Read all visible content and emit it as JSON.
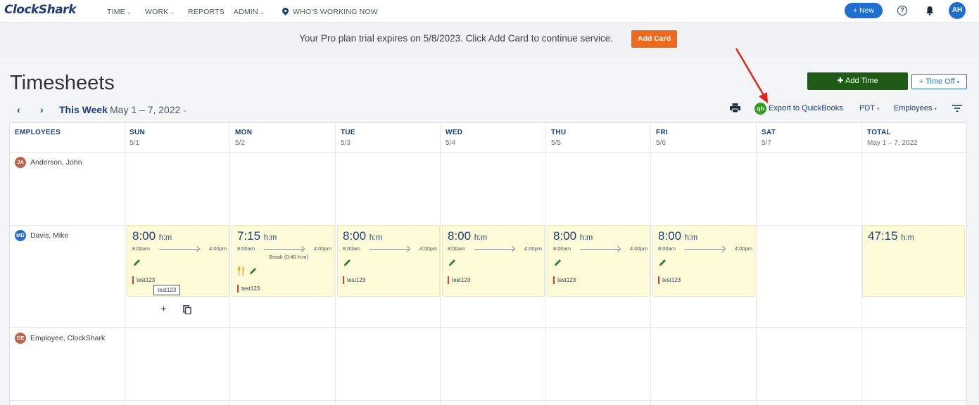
{
  "nav": {
    "logo": "ClockShark",
    "items": [
      "TIME",
      "WORK",
      "REPORTS",
      "ADMIN",
      "WHO'S WORKING NOW"
    ],
    "new_button": "+ New",
    "help_glyph": "?",
    "user_initials": "AH"
  },
  "banner": {
    "message": "Your Pro plan trial expires on 5/8/2023. Click Add Card to continue service.",
    "button": "Add Card"
  },
  "page": {
    "title": "Timesheets",
    "add_time": "Add Time",
    "time_off": "+ Time Off",
    "this_week": "This Week",
    "week_range": "May 1 – 7, 2022"
  },
  "toolbar": {
    "qb_logo": "qb",
    "export_qb": "Export to QuickBooks",
    "timezone": "PDT",
    "employees_filter": "Employees"
  },
  "table": {
    "employees_header": "EMPLOYEES",
    "days": [
      {
        "day": "SUN",
        "date": "5/1"
      },
      {
        "day": "MON",
        "date": "5/2"
      },
      {
        "day": "TUE",
        "date": "5/3"
      },
      {
        "day": "WED",
        "date": "5/4"
      },
      {
        "day": "THU",
        "date": "5/5"
      },
      {
        "day": "FRI",
        "date": "5/6"
      },
      {
        "day": "SAT",
        "date": "5/7"
      },
      {
        "day": "TOTAL",
        "date": "May 1 – 7, 2022"
      }
    ],
    "employees": [
      {
        "initials": "JA",
        "name": "Anderson, John",
        "color": "#c0654a"
      },
      {
        "initials": "MD",
        "name": "Davis, Mike",
        "color": "#1f6fd1"
      },
      {
        "initials": "CE",
        "name": "Employee, ClockShark",
        "color": "#c0654a"
      }
    ],
    "shifts": [
      {
        "hours": "8:00",
        "unit": "h:m",
        "start": "8:00am",
        "end": "4:00pm",
        "tag": "test123"
      },
      {
        "hours": "7:15",
        "unit": "h:m",
        "start": "8:00am",
        "end": "4:00pm",
        "break": "Break (0:45 h:m)",
        "tag": "test123"
      },
      {
        "hours": "8:00",
        "unit": "h:m",
        "start": "8:00am",
        "end": "4:00pm",
        "tag": "test123"
      },
      {
        "hours": "8:00",
        "unit": "h:m",
        "start": "8:00am",
        "end": "4:00pm",
        "tag": "test123"
      },
      {
        "hours": "8:00",
        "unit": "h:m",
        "start": "8:00am",
        "end": "4:00pm",
        "tag": "test123"
      },
      {
        "hours": "8:00",
        "unit": "h:m",
        "start": "8:00am",
        "end": "4:00pm",
        "tag": "test123"
      }
    ],
    "total": {
      "hours": "47:15",
      "unit": "h:m"
    },
    "tooltip": "test123",
    "add_glyph": "+"
  }
}
